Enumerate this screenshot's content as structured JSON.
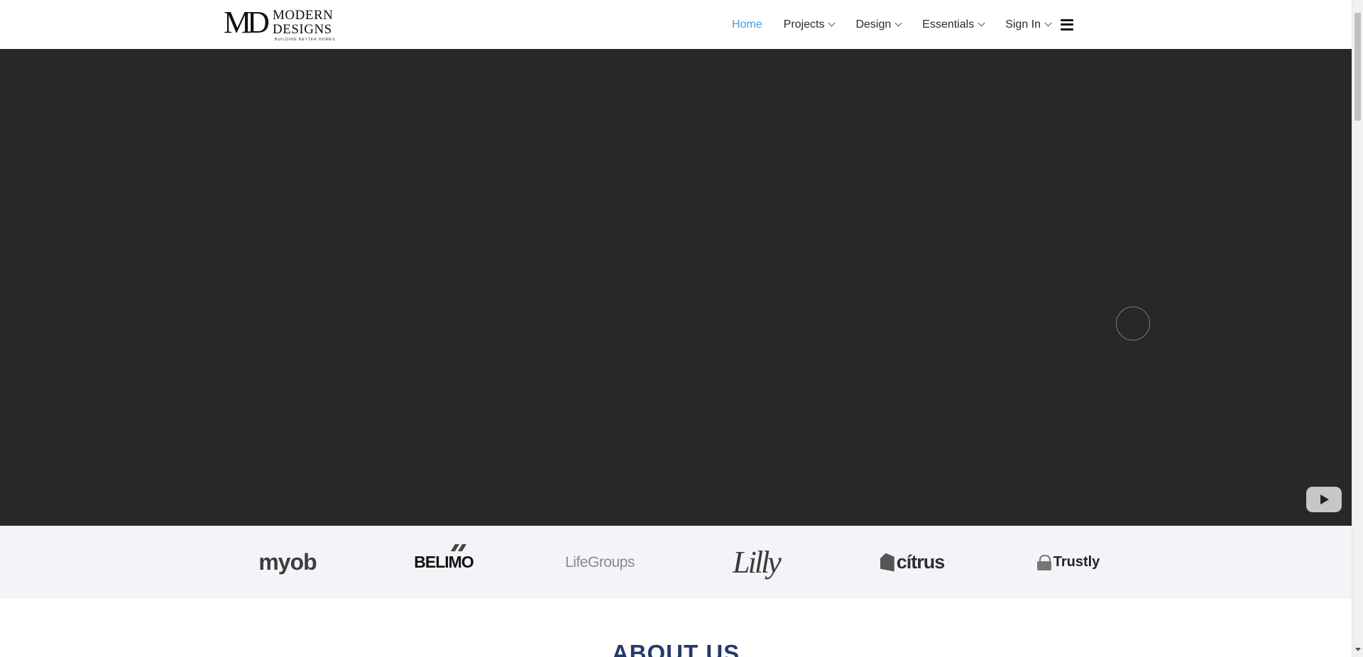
{
  "brand": {
    "monogram": "MD",
    "name_line1": "MODERN",
    "name_line2": "DESIGNS",
    "tagline": "BUILDING BETTER HOMES"
  },
  "nav": {
    "items": [
      {
        "label": "Home",
        "active": true,
        "has_dropdown": false
      },
      {
        "label": "Projects",
        "active": false,
        "has_dropdown": true
      },
      {
        "label": "Design",
        "active": false,
        "has_dropdown": true
      },
      {
        "label": "Essentials",
        "active": false,
        "has_dropdown": true
      },
      {
        "label": "Sign In",
        "active": false,
        "has_dropdown": true
      }
    ],
    "menu_icon": "hamburger-icon"
  },
  "hero": {
    "type": "embedded-video",
    "play_icon": "youtube-play-icon"
  },
  "clients": {
    "logos": [
      "myob",
      "BELIMO",
      "LifeGroups",
      "Lilly",
      "cítrus",
      "Trustly"
    ]
  },
  "about": {
    "title": "ABOUT US"
  },
  "colors": {
    "accent": "#4a9ad6",
    "hero_bg": "#282828",
    "clients_bg": "#f2f4f7",
    "heading": "#25396b"
  }
}
